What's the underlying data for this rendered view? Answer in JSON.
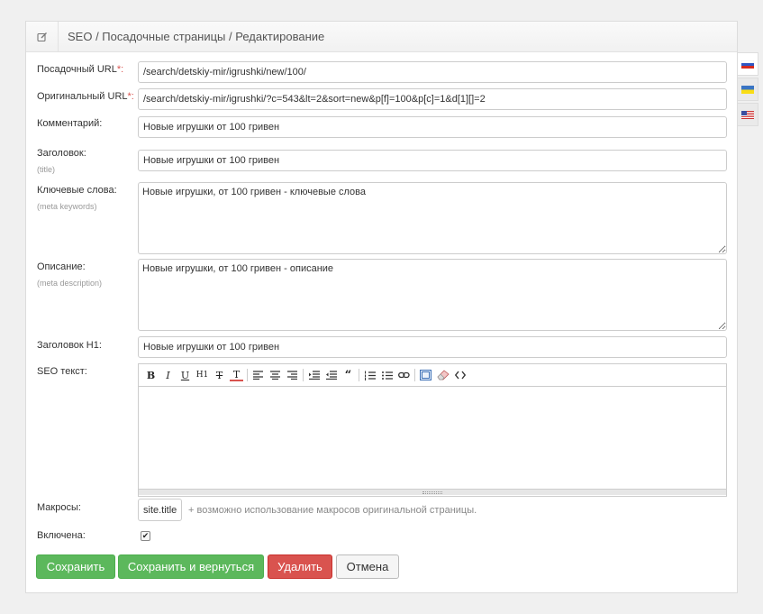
{
  "header": {
    "title": "SEO / Посадочные страницы / Редактирование",
    "icon": "edit-icon"
  },
  "form": {
    "landing_url": {
      "label": "Посадочный URL",
      "required_mark": "*:",
      "value": "/search/detskiy-mir/igrushki/new/100/"
    },
    "original_url": {
      "label": "Оригинальный URL",
      "required_mark": "*:",
      "value": "/search/detskiy-mir/igrushki/?c=543&lt=2&sort=new&p[f]=100&p[c]=1&d[1][]=2"
    },
    "comment": {
      "label": "Комментарий:",
      "value": "Новые игрушки от 100 гривен"
    },
    "title": {
      "label": "Заголовок:",
      "sublabel": "(title)",
      "value": "Новые игрушки от 100 гривен"
    },
    "keywords": {
      "label": "Ключевые слова:",
      "sublabel": "(meta keywords)",
      "value": "Новые игрушки, от 100 гривен - ключевые слова"
    },
    "description": {
      "label": "Описание:",
      "sublabel": "(meta description)",
      "value": "Новые игрушки, от 100 гривен - описание"
    },
    "h1": {
      "label": "Заголовок H1:",
      "value": "Новые игрушки от 100 гривен"
    },
    "seo_text": {
      "label": "SEO текст:",
      "value": "",
      "toolbar": [
        "bold-icon",
        "italic-icon",
        "underline-icon",
        "heading-icon",
        "strikethrough-icon",
        "text-color-icon",
        "align-left-icon",
        "align-center-icon",
        "align-right-icon",
        "indent-icon",
        "outdent-icon",
        "quote-icon",
        "ordered-list-icon",
        "unordered-list-icon",
        "link-icon",
        "fullscreen-icon",
        "eraser-icon",
        "code-icon"
      ]
    },
    "macros": {
      "label": "Макросы:",
      "tag": "site.title",
      "hint": "+ возможно использование макросов оригинальной страницы."
    },
    "enabled": {
      "label": "Включена:",
      "checked": true
    }
  },
  "buttons": {
    "save": "Сохранить",
    "save_return": "Сохранить и вернуться",
    "delete": "Удалить",
    "cancel": "Отмена"
  },
  "languages": [
    {
      "name": "ru-flag-icon",
      "active": true
    },
    {
      "name": "ua-flag-icon",
      "active": false
    },
    {
      "name": "us-flag-icon",
      "active": false
    }
  ],
  "colors": {
    "success": "#5cb85c",
    "danger": "#d9534f",
    "required": "#d9534f"
  }
}
